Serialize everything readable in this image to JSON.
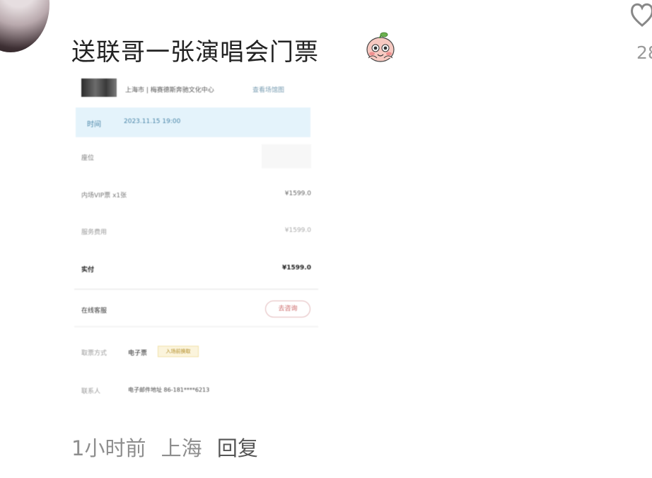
{
  "comment": {
    "text": "送联哥一张演唱会门票",
    "like_count": "28",
    "time": "1小时前",
    "location": "上海",
    "reply_label": "回复"
  },
  "order_screenshot": {
    "title": "上海市 | 梅赛德斯奔驰文化中心",
    "link": "查看场馆图",
    "time_label": "时间",
    "time_value": "2023.11.15 19:00",
    "seat_label": "座位",
    "price_label": "内场VIP票 x1张",
    "price_value": "¥1599.0",
    "service_label": "服务费用",
    "service_value": "¥1599.0",
    "total_label": "实付",
    "total_value": "¥1599.0",
    "customer_service": "在线客服",
    "call_button": "去咨询",
    "delivery_label": "取票方式",
    "delivery_value": "电子票",
    "delivery_tag": "入场前换取",
    "buyer_label": "联系人",
    "buyer_value": "电子邮件地址  86-181****6213"
  }
}
